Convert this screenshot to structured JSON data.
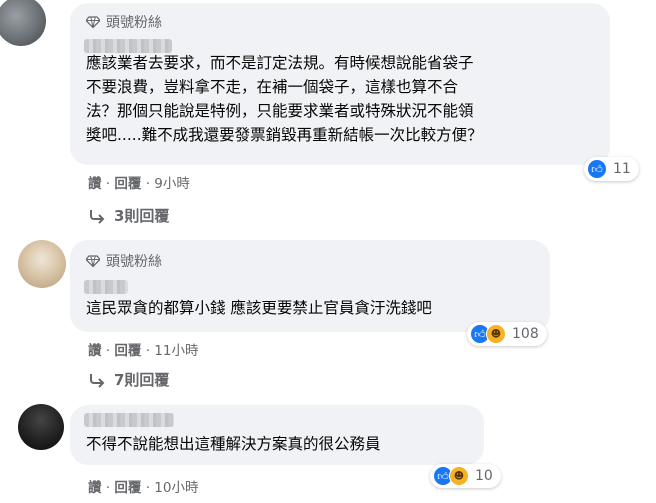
{
  "comments": [
    {
      "badge": "頭號粉絲",
      "lines": [
        "應該業者去要求，而不是訂定法規。有時候想說能省袋子",
        "不要浪費，豈料拿不走，在補一個袋子，這樣也算不合",
        "法？那個只能說是特例，只能要求業者或特殊狀況不能領",
        "獎吧.....難不成我還要發票銷毀再重新結帳一次比較方便？"
      ],
      "reaction_count": "11",
      "reactions": [
        "like-icon"
      ],
      "like_label": "讚",
      "reply_label": "回覆",
      "time": "9小時",
      "view_replies": "3則回覆"
    },
    {
      "badge": "頭號粉絲",
      "lines": [
        "這民眾貪的都算小錢 應該更要禁止官員貪汙洗錢吧"
      ],
      "reaction_count": "108",
      "reactions": [
        "like-icon",
        "haha-icon"
      ],
      "like_label": "讚",
      "reply_label": "回覆",
      "time": "11小時",
      "view_replies": "7則回覆"
    },
    {
      "lines": [
        "不得不說能想出這種解決方案真的很公務員"
      ],
      "reaction_count": "10",
      "reactions": [
        "like-icon",
        "haha-icon"
      ],
      "like_label": "讚",
      "reply_label": "回覆",
      "time": "10小時"
    }
  ],
  "separator": "·",
  "colors": {
    "bubble": "#f0f2f5",
    "like": "#1877f2",
    "haha": "#f7b125",
    "meta": "#65676b"
  }
}
